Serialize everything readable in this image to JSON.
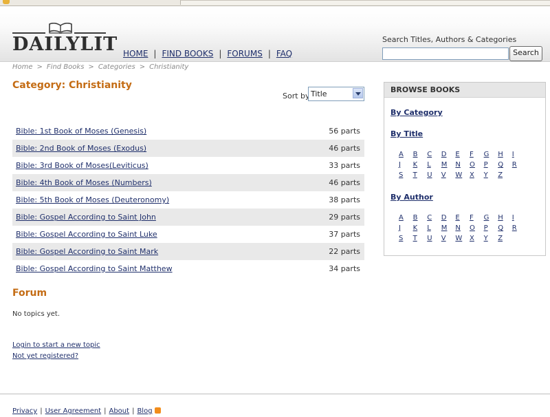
{
  "header": {
    "logo_text": "DAILYLIT",
    "nav": [
      "HOME",
      "FIND BOOKS",
      "FORUMS",
      "FAQ"
    ],
    "nav_separator": "|",
    "search_label": "Search Titles, Authors & Categories",
    "search_value": "",
    "search_button": "Search"
  },
  "breadcrumb": [
    "Home",
    "Find Books",
    "Categories",
    "Christianity"
  ],
  "breadcrumb_separator": ">",
  "category": {
    "title": "Category: Christianity",
    "sort_label": "Sort by",
    "sort_value": "Title",
    "books": [
      {
        "title": "Bible: 1st Book of Moses (Genesis)",
        "parts": "56 parts"
      },
      {
        "title": "Bible: 2nd Book of Moses (Exodus)",
        "parts": "46 parts"
      },
      {
        "title": "Bible: 3rd Book of Moses(Leviticus)",
        "parts": "33 parts"
      },
      {
        "title": "Bible: 4th Book of Moses (Numbers)",
        "parts": "46 parts"
      },
      {
        "title": "Bible: 5th Book of Moses (Deuteronomy)",
        "parts": "38 parts"
      },
      {
        "title": "Bible: Gospel According to Saint John",
        "parts": "29 parts"
      },
      {
        "title": "Bible: Gospel According to Saint Luke",
        "parts": "37 parts"
      },
      {
        "title": "Bible: Gospel According to Saint Mark",
        "parts": "22 parts"
      },
      {
        "title": "Bible: Gospel According to Saint Matthew",
        "parts": "34 parts"
      }
    ]
  },
  "forum": {
    "title": "Forum",
    "empty_text": "No topics yet.",
    "login_link": "Login to start a new topic",
    "register_link": "Not yet registered?"
  },
  "browse": {
    "title": "BROWSE BOOKS",
    "by_category": "By Category",
    "by_title": "By Title",
    "by_author": "By Author",
    "letters": [
      "A",
      "B",
      "C",
      "D",
      "E",
      "F",
      "G",
      "H",
      "I",
      "J",
      "K",
      "L",
      "M",
      "N",
      "O",
      "P",
      "Q",
      "R",
      "S",
      "T",
      "U",
      "V",
      "W",
      "X",
      "Y",
      "Z"
    ]
  },
  "footer": {
    "links": [
      "Privacy",
      "User Agreement",
      "About",
      "Blog"
    ],
    "separator": "|",
    "rss_icon": "rss-icon"
  },
  "colors": {
    "accent": "#c46c14",
    "link": "#1f2f6b",
    "row_alt": "#e9e9e9"
  }
}
